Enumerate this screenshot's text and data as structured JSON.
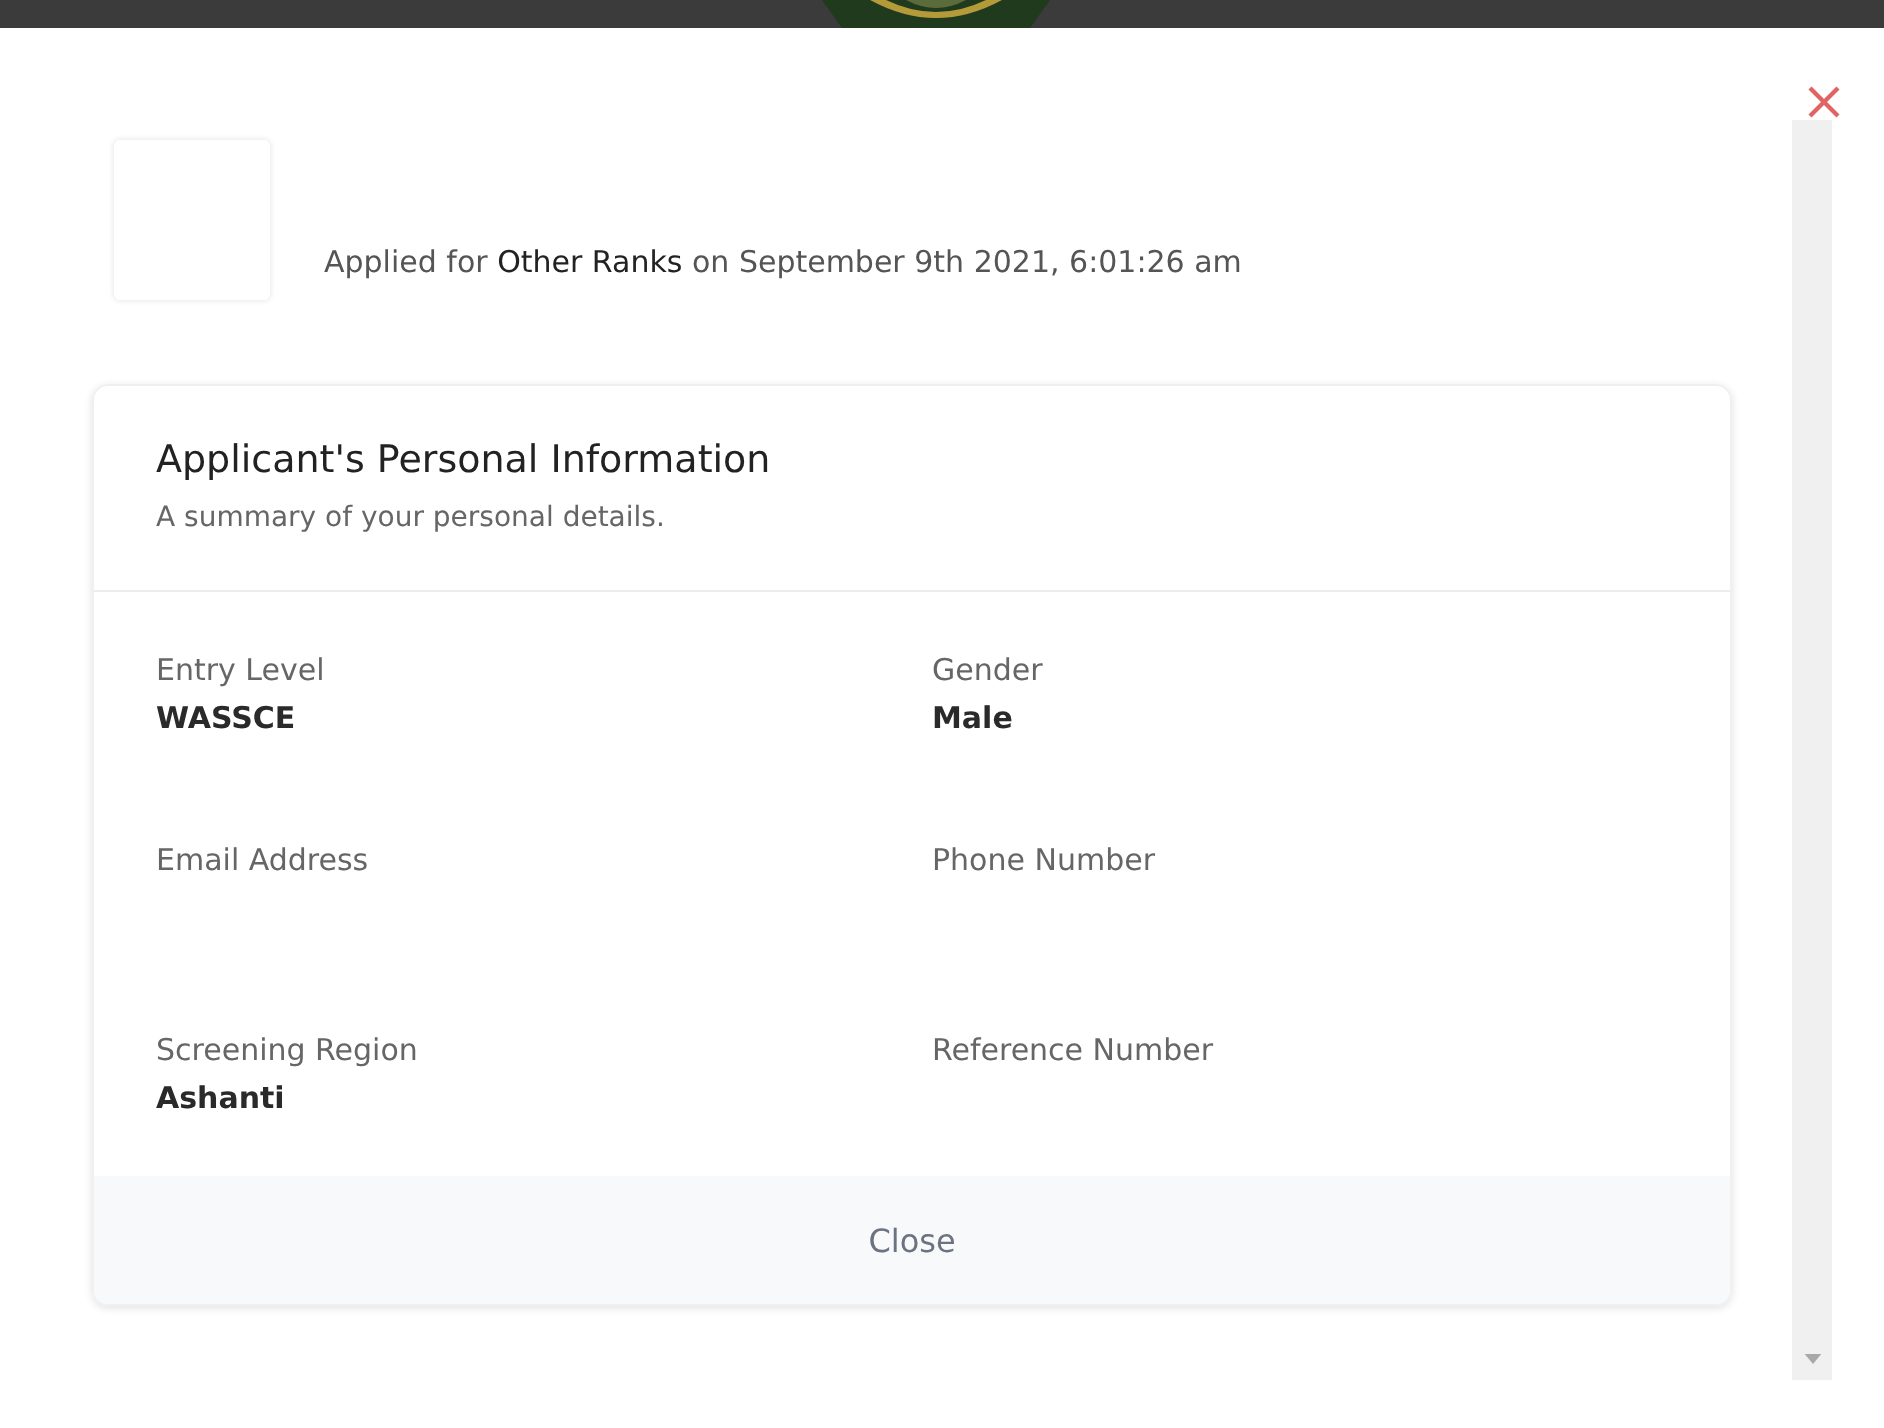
{
  "applicant": {
    "applied_text": "Applied for **Other Ranks** on September 9th 2021, 6:01:26 am"
  },
  "card": {
    "title": "Applicant's Personal Information",
    "subtitle": "A summary of your personal details.",
    "fields": [
      {
        "label": "Entry Level",
        "value": "WASSCE"
      },
      {
        "label": "Gender",
        "value": "Male"
      },
      {
        "label": "Email Address"
      },
      {
        "label": "Phone Number"
      },
      {
        "label": "Screening Region",
        "value": "Ashanti"
      },
      {
        "label": "Reference Number"
      }
    ],
    "footer_button": "Close"
  }
}
